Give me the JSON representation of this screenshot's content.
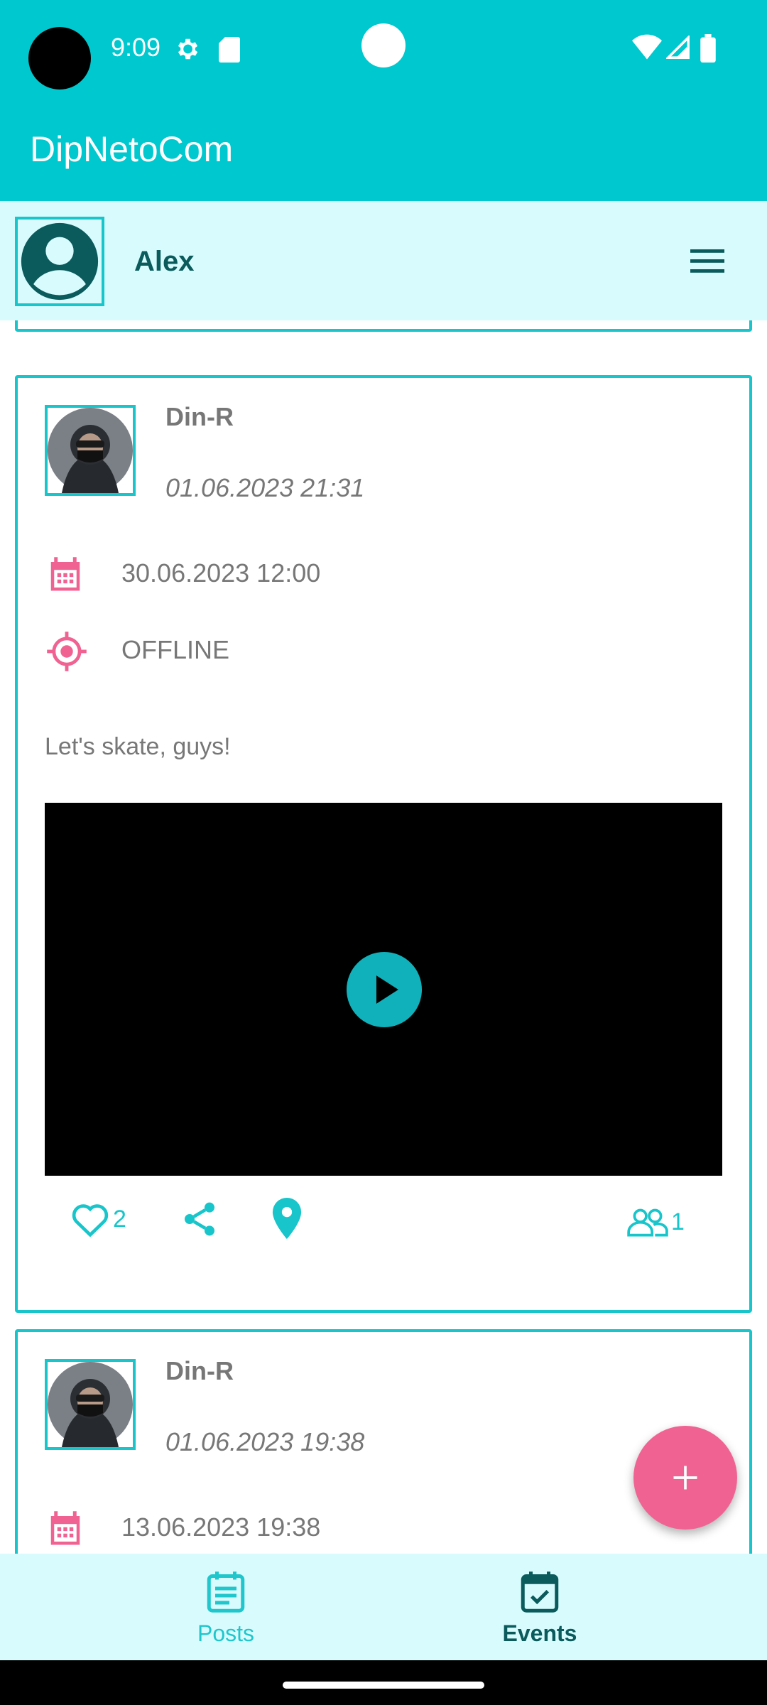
{
  "status_bar": {
    "time": "9:09"
  },
  "app_bar": {
    "title": "DipNetoCom"
  },
  "profile": {
    "name": "Alex"
  },
  "events": [
    {
      "author": "Din-R",
      "published": "01.06.2023 21:31",
      "datetime": "30.06.2023 12:00",
      "type": "OFFLINE",
      "content": "Let's skate, guys!",
      "likes": "2",
      "participants": "1"
    },
    {
      "author": "Din-R",
      "published": "01.06.2023 19:38",
      "datetime": "13.06.2023 19:38"
    }
  ],
  "bottom_nav": {
    "posts_label": "Posts",
    "events_label": "Events"
  },
  "colors": {
    "primary": "#00c8cf",
    "accent": "#f06292",
    "surface_tint": "#d8fcfe",
    "dark_teal": "#0b5a5c"
  }
}
